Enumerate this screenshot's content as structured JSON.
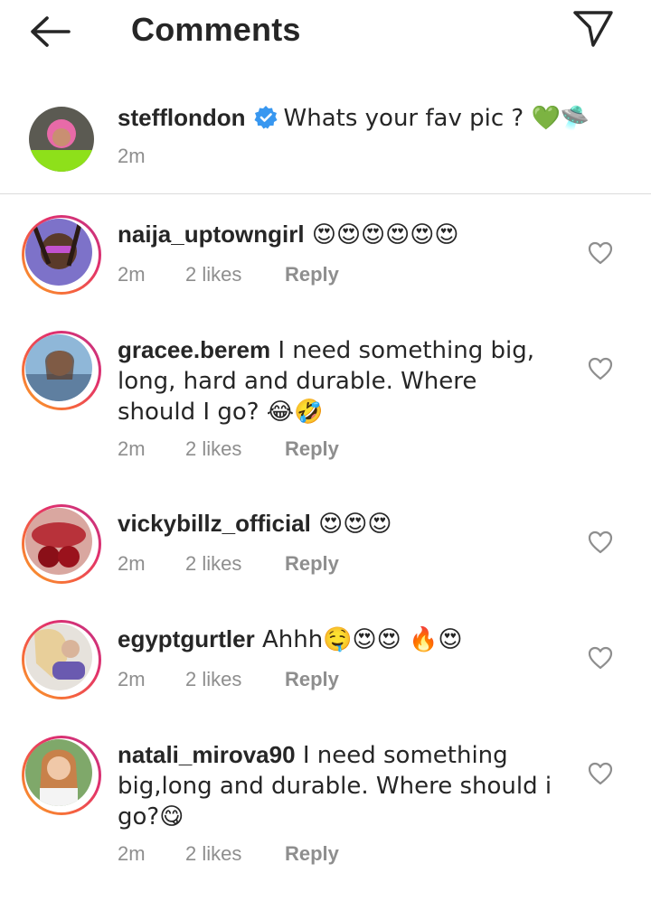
{
  "header": {
    "title": "Comments"
  },
  "caption": {
    "username": "stefflondon",
    "text": "Whats your fav pic ? 💚🛸",
    "time": "2m"
  },
  "comments": [
    {
      "username": "naija_uptowngirl",
      "text": " 😍😍😍😍😍😍",
      "time": "2m",
      "likes": "2 likes",
      "reply": "Reply"
    },
    {
      "username": "gracee.berem",
      "text": " I need something big, long, hard and durable. Where should I go? 😂🤣",
      "time": "2m",
      "likes": "2 likes",
      "reply": "Reply"
    },
    {
      "username": "vickybillz_official",
      "text": " 😍😍😍",
      "time": "2m",
      "likes": "2 likes",
      "reply": "Reply"
    },
    {
      "username": "egyptgurtler",
      "text": " Ahhh🤤😍😍 🔥😍",
      "time": "2m",
      "likes": "2 likes",
      "reply": "Reply"
    },
    {
      "username": "natali_mirova90",
      "text": " I need something big,long and durable. Where should i go?😋",
      "time": "2m",
      "likes": "2 likes",
      "reply": "Reply"
    }
  ],
  "icons": {
    "back": "arrow-left-icon",
    "send": "paper-plane-icon",
    "verified": "verified-badge-icon",
    "like": "heart-outline-icon"
  },
  "colors": {
    "verified": "#3897f0",
    "meta_text": "#8e8e8e",
    "text": "#262626",
    "story_ring_start": "#f9a825",
    "story_ring_end": "#c13584"
  }
}
